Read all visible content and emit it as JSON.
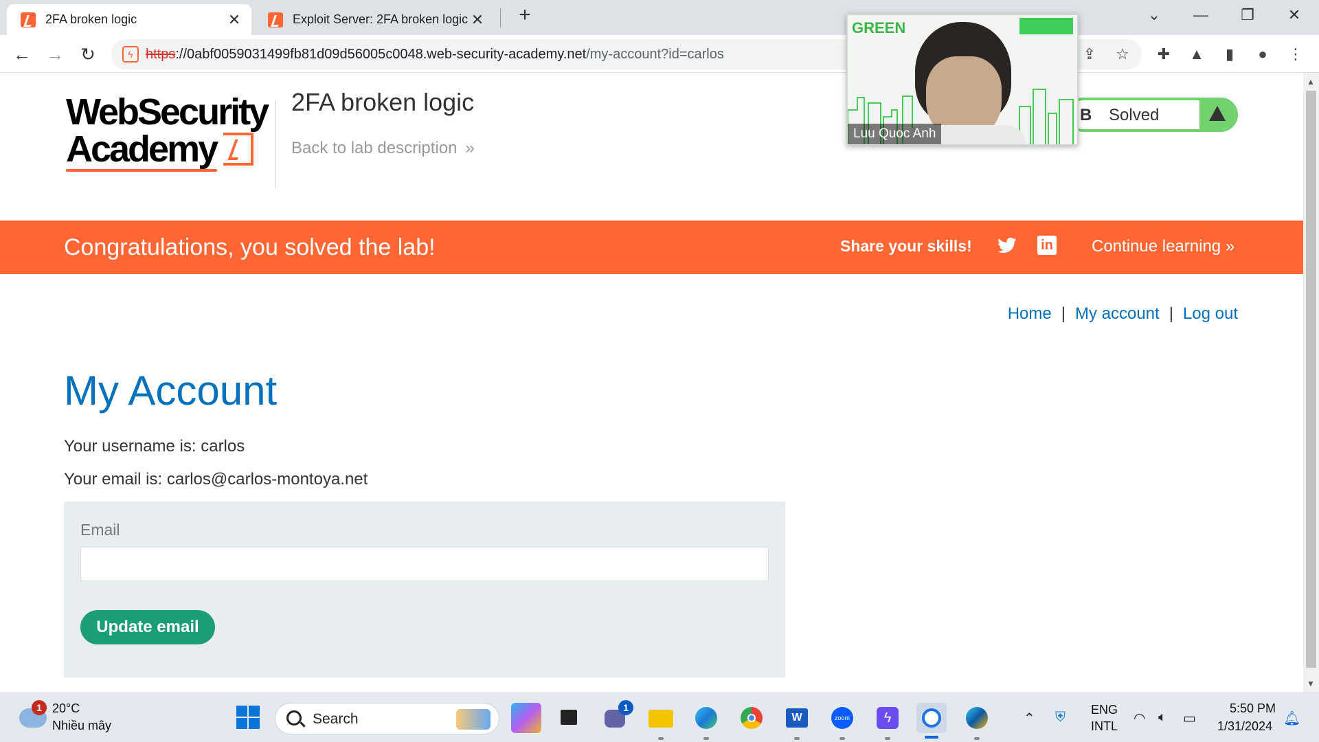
{
  "browser": {
    "tabs": [
      {
        "title": "2FA broken logic",
        "active": true
      },
      {
        "title": "Exploit Server: 2FA broken logic",
        "active": false
      }
    ],
    "new_tab_glyph": "+",
    "url_scheme": "https",
    "url_host": "://0abf0059031499fb81d09d56005c0048.web-security-academy.net",
    "url_path": "/my-account?id=carlos",
    "icons": [
      "back-icon",
      "forward-icon",
      "reload-icon",
      "share-icon",
      "star-icon",
      "extensions-icon",
      "labs-icon",
      "sidepanel-icon",
      "profile-icon",
      "menu-icon"
    ]
  },
  "header": {
    "logo_line1": "WebSecurity",
    "logo_line2": "Academy",
    "lab_title": "2FA broken logic",
    "back_link": "Back to lab description",
    "status_prefix": "B",
    "status": "Solved"
  },
  "banner": {
    "message": "Congratulations, you solved the lab!",
    "share": "Share your skills!",
    "continue": "Continue learning"
  },
  "nav": {
    "home": "Home",
    "my_account": "My account",
    "log_out": "Log out",
    "separator": "|"
  },
  "account": {
    "heading": "My Account",
    "username_line": "Your username is: carlos",
    "email_line": "Your email is: carlos@carlos-montoya.net",
    "email_label": "Email",
    "email_value": "",
    "update_button": "Update email"
  },
  "video_overlay": {
    "participant": "Luu Quoc Anh",
    "logo_text": "GREEN"
  },
  "taskbar": {
    "weather_temp": "20°C",
    "weather_desc": "Nhiều mây",
    "weather_badge": "1",
    "search_placeholder": "Search",
    "teams_badge": "1",
    "lang_line1": "ENG",
    "lang_line2": "INTL",
    "time": "5:50 PM",
    "date": "1/31/2024"
  },
  "colors": {
    "brand_orange": "#ff6633",
    "link_blue": "#0071bc",
    "button_green": "#1b9e77",
    "solved_green": "#70d16d"
  }
}
